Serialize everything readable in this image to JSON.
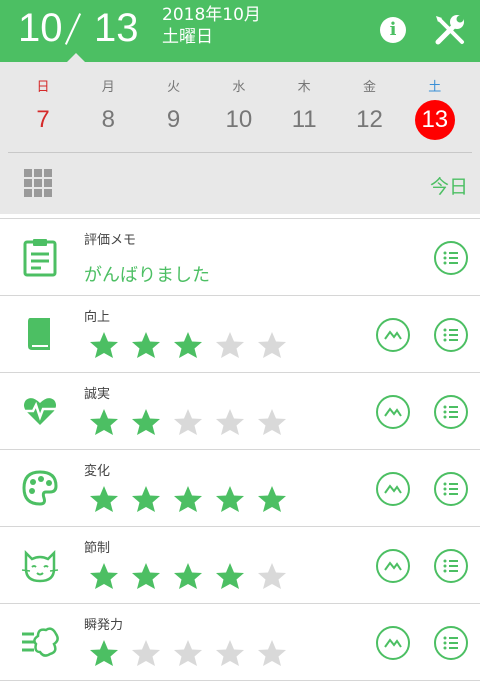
{
  "header": {
    "month": "10",
    "day": "13",
    "year_month": "2018年10月",
    "weekday": "土曜日"
  },
  "week": [
    {
      "weekday": "日",
      "day": "7",
      "type": "sun"
    },
    {
      "weekday": "月",
      "day": "8",
      "type": ""
    },
    {
      "weekday": "火",
      "day": "9",
      "type": ""
    },
    {
      "weekday": "水",
      "day": "10",
      "type": ""
    },
    {
      "weekday": "木",
      "day": "11",
      "type": ""
    },
    {
      "weekday": "金",
      "day": "12",
      "type": ""
    },
    {
      "weekday": "土",
      "day": "13",
      "type": "sat selected"
    }
  ],
  "today_label": "今日",
  "memo": {
    "label": "評価メモ",
    "text": "がんばりました"
  },
  "ratings": [
    {
      "label": "向上",
      "stars": 3,
      "icon": "book-icon"
    },
    {
      "label": "誠実",
      "stars": 2,
      "icon": "heart-pulse-icon"
    },
    {
      "label": "変化",
      "stars": 5,
      "icon": "palette-icon"
    },
    {
      "label": "節制",
      "stars": 4,
      "icon": "cat-icon"
    },
    {
      "label": "瞬発力",
      "stars": 1,
      "icon": "wind-icon"
    }
  ],
  "colors": {
    "accent": "#4cbf63",
    "star_off": "#d9d9d9",
    "selected_day": "#ff0000"
  }
}
